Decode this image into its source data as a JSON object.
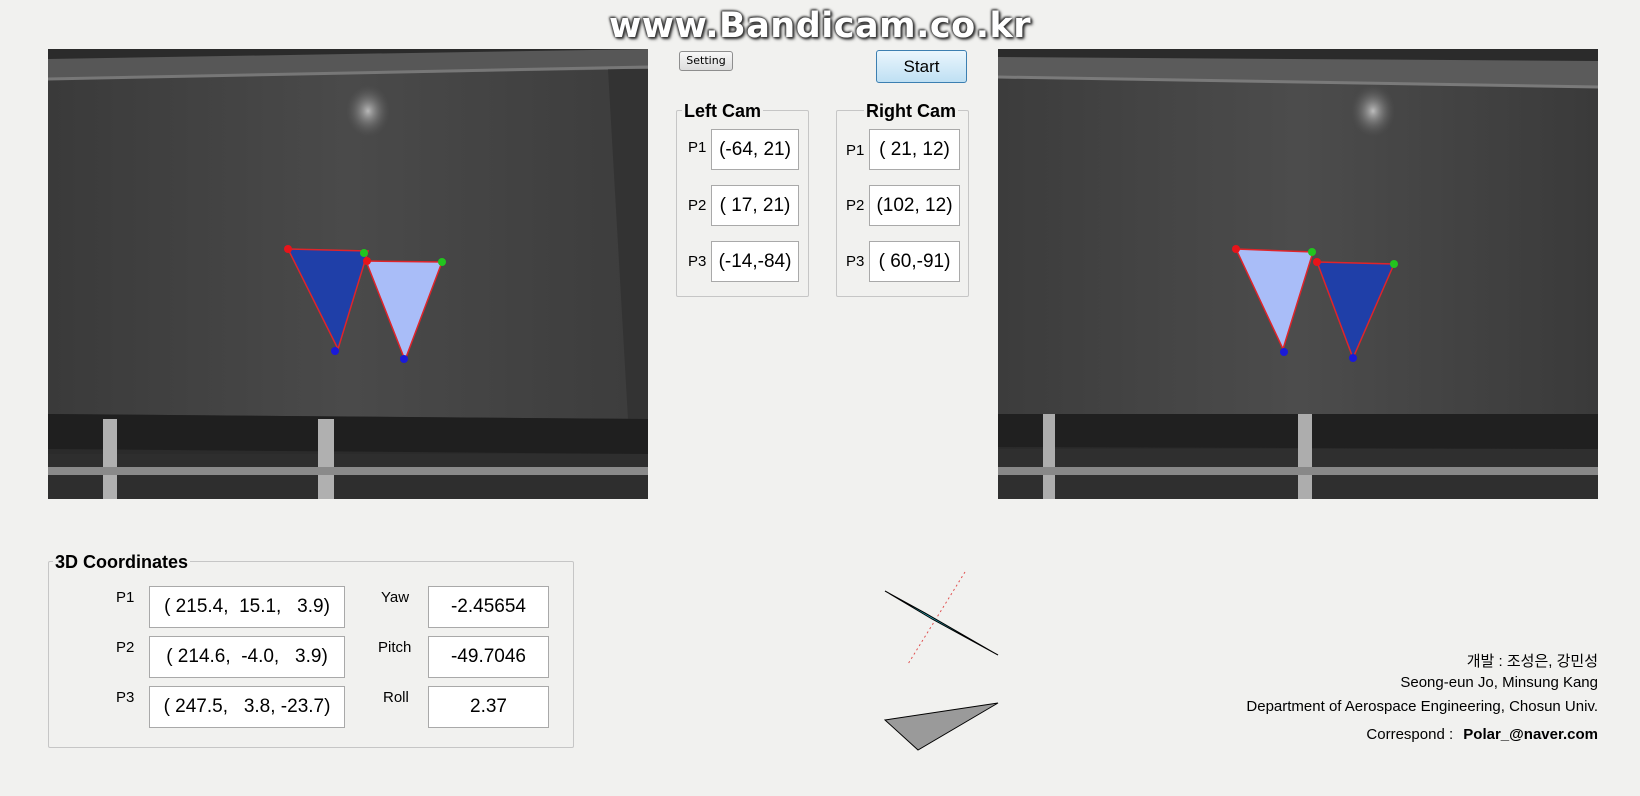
{
  "watermark": "www.Bandicam.co.kr",
  "buttons": {
    "setting": "Setting",
    "start": "Start"
  },
  "left_cam": {
    "title": "Left Cam",
    "points": [
      {
        "label": "P1",
        "value": "(-64, 21)"
      },
      {
        "label": "P2",
        "value": "( 17, 21)"
      },
      {
        "label": "P3",
        "value": "(-14,-84)"
      }
    ]
  },
  "right_cam": {
    "title": "Right Cam",
    "points": [
      {
        "label": "P1",
        "value": "( 21, 12)"
      },
      {
        "label": "P2",
        "value": "(102, 12)"
      },
      {
        "label": "P3",
        "value": "( 60,-91)"
      }
    ]
  },
  "coords3d": {
    "title": "3D Coordinates",
    "points": [
      {
        "label": "P1",
        "value": "( 215.4,  15.1,   3.9)"
      },
      {
        "label": "P2",
        "value": "( 214.6,  -4.0,   3.9)"
      },
      {
        "label": "P3",
        "value": "( 247.5,   3.8, -23.7)"
      }
    ],
    "angles": [
      {
        "label": "Yaw",
        "value": "-2.45654"
      },
      {
        "label": "Pitch",
        "value": "-49.7046"
      },
      {
        "label": "Roll",
        "value": "2.37"
      }
    ]
  },
  "credits": {
    "korean": "개발 : 조성은, 강민성",
    "names": "Seong-eun Jo, Minsung Kang",
    "dept": "Department of Aerospace Engineering, Chosun Univ.",
    "correspond_label": "Correspond  :",
    "email": "Polar_@naver.com"
  },
  "colors": {
    "dark_triangle": "#1f3fa8",
    "light_triangle": "#a9bdf8",
    "edge": "#e0242a",
    "marker_red": "#e8141a",
    "marker_green": "#22c41e",
    "marker_blue": "#1a1ad8",
    "preview_cyan": "#29c3d6",
    "preview_gray": "#9a9a9a"
  }
}
